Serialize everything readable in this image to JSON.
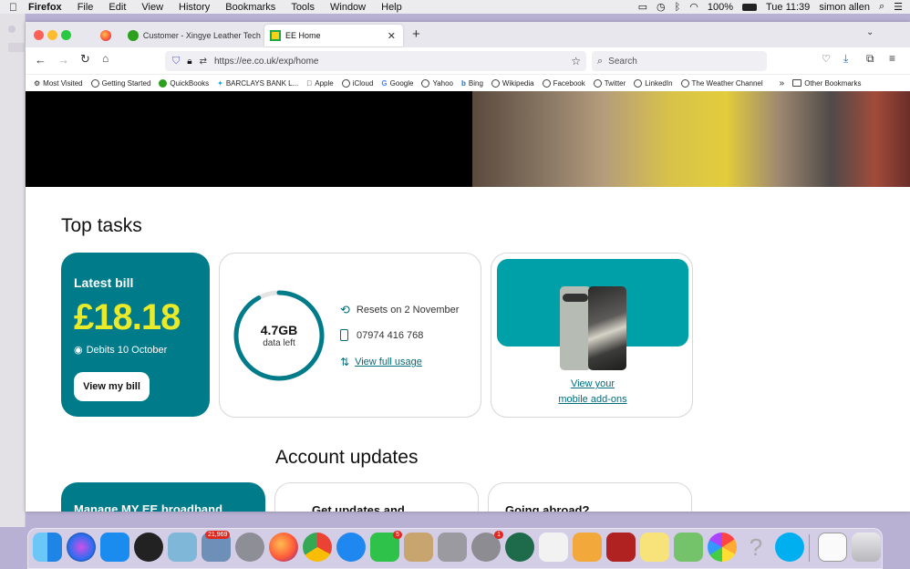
{
  "menubar": {
    "app_name": "Firefox",
    "items": [
      "File",
      "Edit",
      "View",
      "History",
      "Bookmarks",
      "Tools",
      "Window",
      "Help"
    ],
    "battery": "100%",
    "clock": "Tue 11:39",
    "user": "simon allen"
  },
  "tabs": [
    {
      "label": "Customer - Xingye Leather Tech",
      "active": false
    },
    {
      "label": "EE Home",
      "active": true
    }
  ],
  "urlbar": {
    "url": "https://ee.co.uk/exp/home"
  },
  "searchbar": {
    "placeholder": "Search"
  },
  "bookmarks": {
    "items": [
      "Most Visited",
      "Getting Started",
      "QuickBooks",
      "BARCLAYS BANK L...",
      "Apple",
      "iCloud",
      "Google",
      "Yahoo",
      "Bing",
      "Wikipedia",
      "Facebook",
      "Twitter",
      "LinkedIn",
      "The Weather Channel"
    ],
    "other": "Other Bookmarks"
  },
  "page": {
    "top_tasks_heading": "Top tasks",
    "bill": {
      "title": "Latest bill",
      "amount": "£18.18",
      "debits": "Debits 10 October",
      "button": "View my bill"
    },
    "usage": {
      "amount": "4.7GB",
      "caption": "data left",
      "resets": "Resets on 2 November",
      "number": "07974 416 768",
      "link": "View full usage",
      "remaining_fraction": 0.92
    },
    "addons": {
      "link_line1": "View your",
      "link_line2": "mobile add-ons"
    },
    "account_updates_heading": "Account updates",
    "partial_card_1": "Manage MY EE broadband",
    "partial_card_2": "Get updates and...",
    "partial_card_3": "Going abroad?"
  },
  "dock": {
    "badges": {
      "photos": "21,969",
      "facetime": "5",
      "sysprefs": "1"
    }
  },
  "colors": {
    "ee_teal": "#007b8a",
    "bill_yellow": "#e8ea2a",
    "phone_tile": "#00a0a8"
  }
}
